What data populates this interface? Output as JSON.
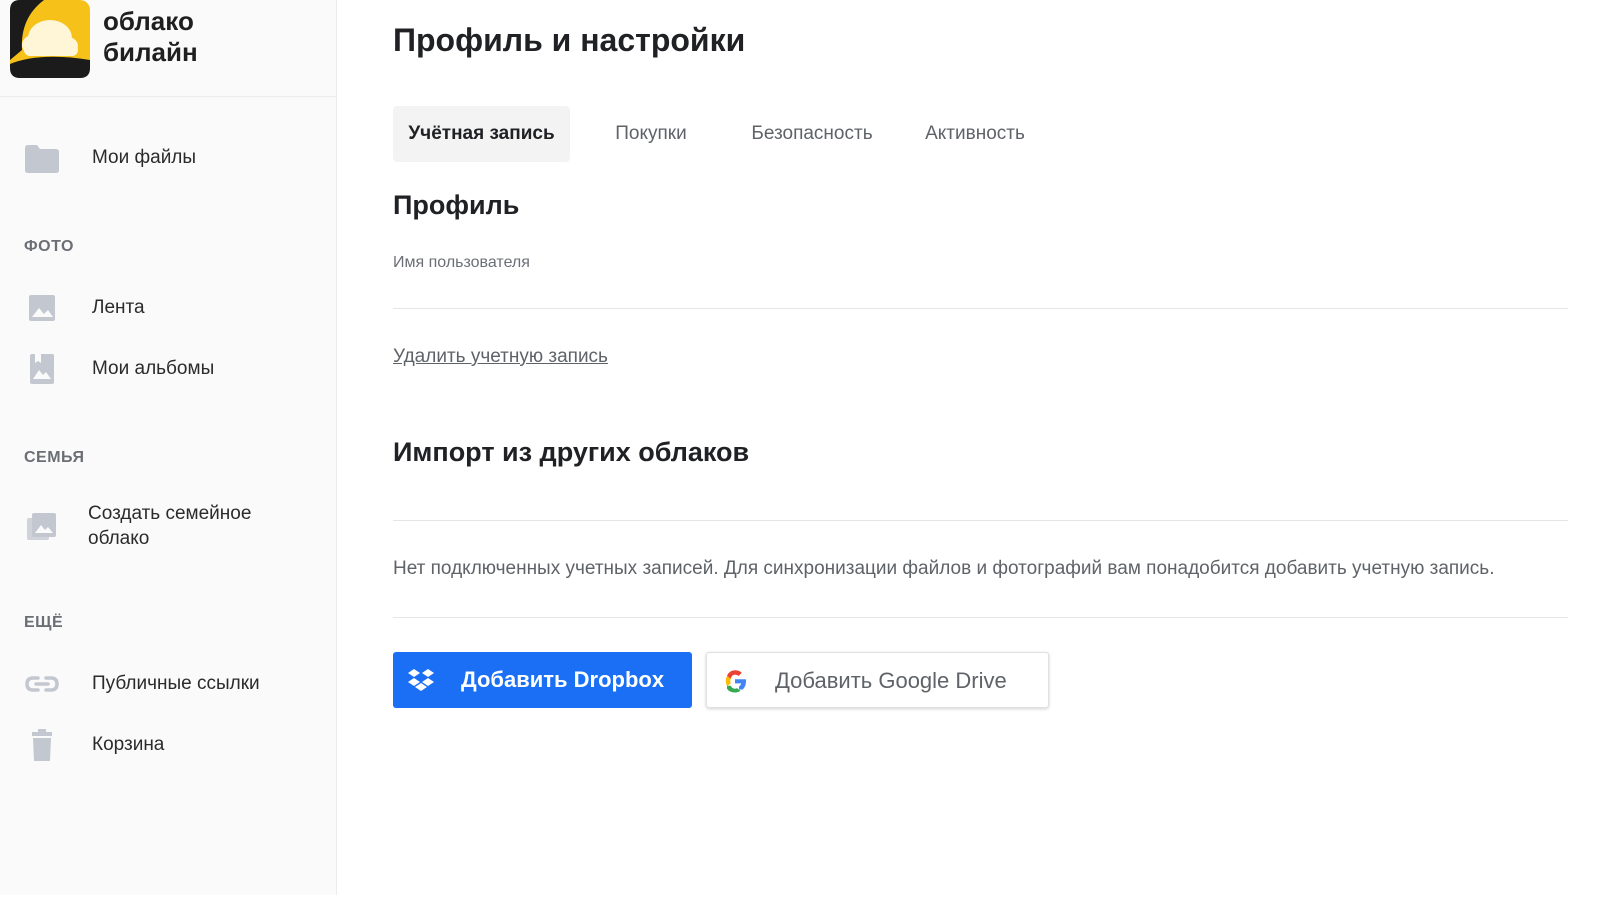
{
  "brand": {
    "line1": "облако",
    "line2": "билайн"
  },
  "sidebar": {
    "my_files": "Мои файлы",
    "section_photo": "ФОТО",
    "feed": "Лента",
    "albums": "Мои альбомы",
    "section_family": "СЕМЬЯ",
    "family_line1": "Создать семейное",
    "family_line2": "облако",
    "section_more": "ЕЩЁ",
    "public_links": "Публичные ссылки",
    "trash": "Корзина"
  },
  "page": {
    "title": "Профиль и настройки"
  },
  "tabs": [
    "Учётная запись",
    "Покупки",
    "Безопасность",
    "Активность"
  ],
  "profile": {
    "heading": "Профиль",
    "username_label": "Имя пользователя",
    "delete_link": "Удалить учетную запись"
  },
  "import": {
    "heading": "Импорт из других облаков",
    "info": "Нет подключенных учетных записей. Для синхронизации файлов и фотографий вам понадобится добавить учетную запись.",
    "dropbox_button": "Добавить Dropbox",
    "google_button": "Добавить Google Drive"
  },
  "colors": {
    "accent": "#1a6ff5",
    "brand_yellow": "#f6c21a",
    "icon_gray": "#c3c8d0"
  },
  "icons": [
    "folder-icon",
    "image-icon",
    "album-icon",
    "family-icon",
    "link-icon",
    "trash-icon",
    "dropbox-icon",
    "google-icon"
  ]
}
